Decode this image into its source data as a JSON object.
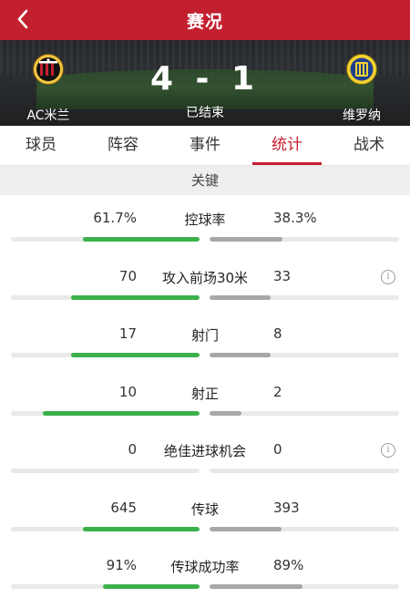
{
  "header": {
    "title": "赛况"
  },
  "match": {
    "home_team": "AC米兰",
    "away_team": "维罗纳",
    "score": "4 - 1",
    "status": "已结束"
  },
  "tabs": [
    {
      "label": "球员"
    },
    {
      "label": "阵容"
    },
    {
      "label": "事件"
    },
    {
      "label": "统计",
      "active": true
    },
    {
      "label": "战术"
    }
  ],
  "section": {
    "title": "关键"
  },
  "stats": [
    {
      "label": "控球率",
      "home": "61.7%",
      "away": "38.3%",
      "home_share": 0.617,
      "away_share": 0.383,
      "info": false
    },
    {
      "label": "攻入前场30米",
      "home": "70",
      "away": "33",
      "home_share": 0.68,
      "away_share": 0.32,
      "info": true,
      "info_icon": "info-icon"
    },
    {
      "label": "射门",
      "home": "17",
      "away": "8",
      "home_share": 0.68,
      "away_share": 0.32,
      "info": false
    },
    {
      "label": "射正",
      "home": "10",
      "away": "2",
      "home_share": 0.83,
      "away_share": 0.17,
      "info": false
    },
    {
      "label": "绝佳进球机会",
      "home": "0",
      "away": "0",
      "home_share": 0,
      "away_share": 0,
      "info": true,
      "info_icon": "info-icon"
    },
    {
      "label": "传球",
      "home": "645",
      "away": "393",
      "home_share": 0.62,
      "away_share": 0.38,
      "info": false
    },
    {
      "label": "传球成功率",
      "home": "91%",
      "away": "89%",
      "home_share": 0.51,
      "away_share": 0.49,
      "info": false
    }
  ],
  "colors": {
    "brand_red": "#c3202f",
    "home_bar": "#3ab14a",
    "away_bar": "#a8a8a8",
    "bar_track": "#e9e9e9",
    "section_bg": "#efefef"
  }
}
